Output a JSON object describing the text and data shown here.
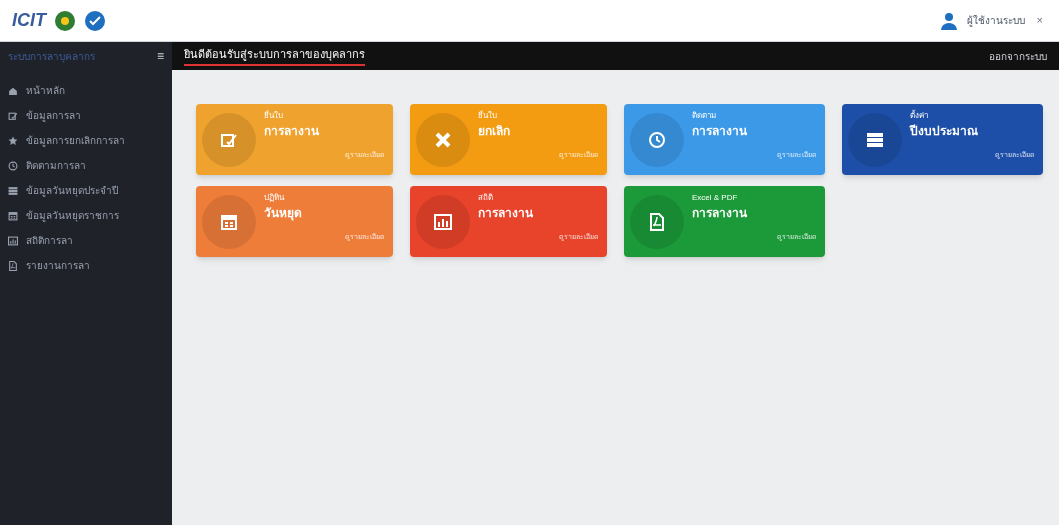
{
  "topbar": {
    "logo_text": "ICIT",
    "user_name": "ผู้ใช้งานระบบ",
    "user_menu": "×"
  },
  "sidebar": {
    "title": "ระบบการลาบุคลากร",
    "toggle": "≡",
    "items": [
      {
        "label": "หน้าหลัก"
      },
      {
        "label": "ข้อมูลการลา"
      },
      {
        "label": "ข้อมูลการยกเลิกการลา"
      },
      {
        "label": "ติดตามการลา"
      },
      {
        "label": "ข้อมูลวันหยุดประจำปี"
      },
      {
        "label": "ข้อมูลวันหยุดราชการ"
      },
      {
        "label": "สถิติการลา"
      },
      {
        "label": "รายงานการลา"
      }
    ]
  },
  "header": {
    "title": "ยินดีต้อนรับสู่ระบบการลาของบุคลากร",
    "logout": "ออกจากระบบ"
  },
  "cards": [
    {
      "caption": "ยื่นใบ",
      "title": "การลางาน",
      "link": "ดูรายละเอียด",
      "color": "#f0a22e"
    },
    {
      "caption": "ยื่นใบ",
      "title": "ยกเลิก",
      "link": "ดูรายละเอียด",
      "color": "#f39c12"
    },
    {
      "caption": "ติดตาม",
      "title": "การลางาน",
      "link": "ดูรายละเอียด",
      "color": "#3c99e8"
    },
    {
      "caption": "ตั้งค่า",
      "title": "ปีงบประมาณ",
      "link": "ดูรายละเอียด",
      "color": "#1e4fa8"
    },
    {
      "caption": "ปฏิทิน",
      "title": "วันหยุด",
      "link": "ดูรายละเอียด",
      "color": "#ef7d3a"
    },
    {
      "caption": "สถิติ",
      "title": "การลางาน",
      "link": "ดูรายละเอียด",
      "color": "#e8432b"
    },
    {
      "caption": "Excel & PDF",
      "title": "การลางาน",
      "link": "ดูรายละเอียด",
      "color": "#1c9a3a"
    }
  ]
}
